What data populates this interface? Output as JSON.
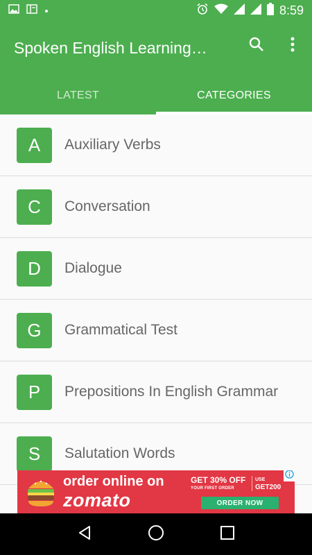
{
  "status_bar": {
    "time": "8:59",
    "icons": [
      "image-icon",
      "app-icon",
      "dot-icon",
      "alarm-icon",
      "wifi-icon",
      "signal-icon",
      "signal-icon",
      "battery-icon"
    ]
  },
  "app_bar": {
    "title": "Spoken English Learning…",
    "actions": [
      "search-icon",
      "more-vert-icon"
    ]
  },
  "tabs": [
    {
      "label": "LATEST",
      "selected": false
    },
    {
      "label": "CATEGORIES",
      "selected": true
    }
  ],
  "categories": [
    {
      "letter": "A",
      "label": "Auxiliary Verbs"
    },
    {
      "letter": "C",
      "label": "Conversation"
    },
    {
      "letter": "D",
      "label": "Dialogue"
    },
    {
      "letter": "G",
      "label": "Grammatical Test"
    },
    {
      "letter": "P",
      "label": "Prepositions In English Grammar"
    },
    {
      "letter": "S",
      "label": "Salutation Words"
    }
  ],
  "ad": {
    "line1": "order online on",
    "brand": "zomato",
    "offer_big": "GET 30% OFF",
    "offer_small": "YOUR FIRST ORDER",
    "code_label": "USE",
    "code": "GET200",
    "cta": "ORDER NOW"
  },
  "nav_bar": {
    "buttons": [
      "back-icon",
      "home-icon",
      "recents-icon"
    ]
  },
  "colors": {
    "primary": "#4cae4f",
    "text_secondary": "#666666",
    "ad_red": "#e23744",
    "ad_green": "#2ab06f"
  }
}
